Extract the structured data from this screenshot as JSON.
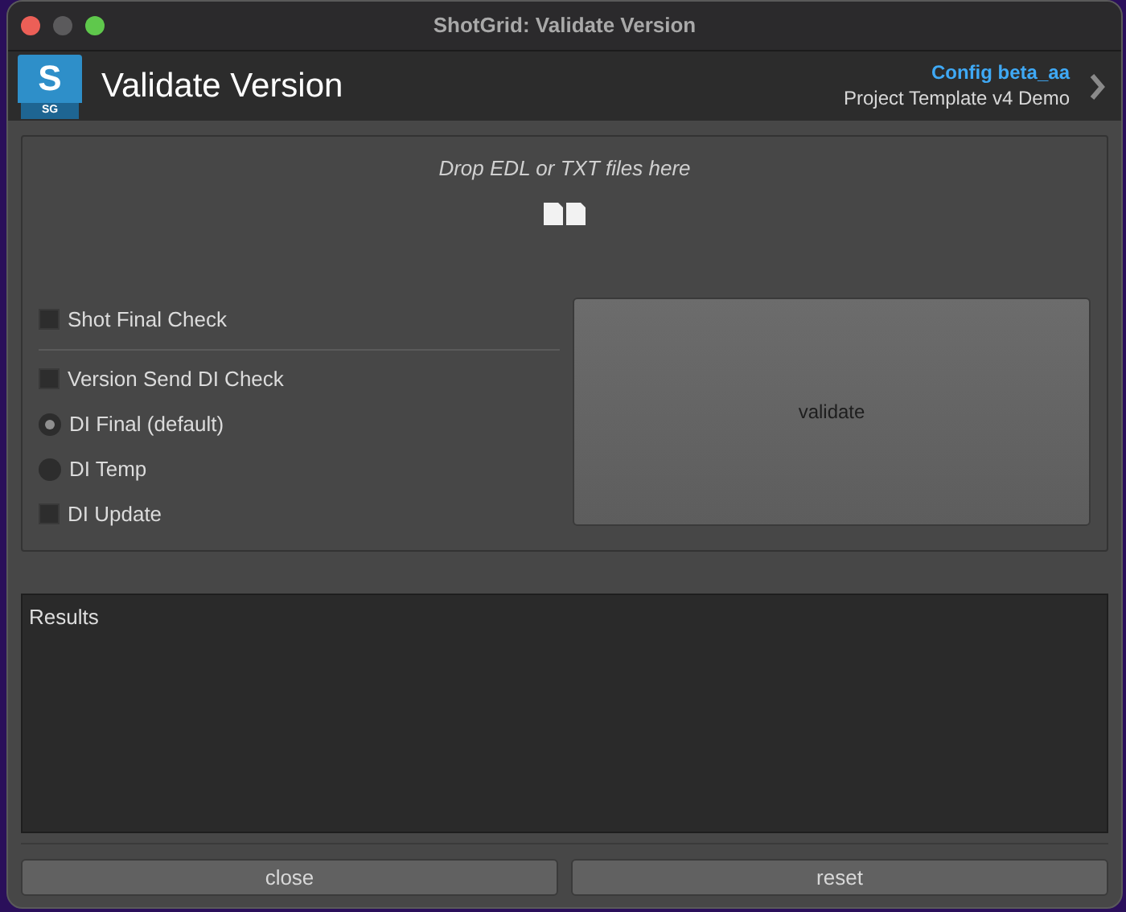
{
  "window": {
    "title": "ShotGrid: Validate Version"
  },
  "header": {
    "logo_text": "S",
    "logo_badge": "SG",
    "title": "Validate Version",
    "config": "Config beta_aa",
    "project": "Project Template v4 Demo"
  },
  "drop_zone": {
    "hint": "Drop EDL or TXT files here"
  },
  "options": [
    {
      "kind": "checkbox",
      "label": "Shot Final Check",
      "checked": false,
      "divider_after": true
    },
    {
      "kind": "checkbox",
      "label": "Version Send DI Check",
      "checked": false
    },
    {
      "kind": "radio",
      "label": "DI Final (default)",
      "selected": true
    },
    {
      "kind": "radio",
      "label": "DI Temp",
      "selected": false
    },
    {
      "kind": "checkbox",
      "label": "DI Update",
      "checked": false
    }
  ],
  "validate_button": "validate",
  "results": {
    "label": "Results"
  },
  "buttons": [
    "close",
    "reset"
  ]
}
